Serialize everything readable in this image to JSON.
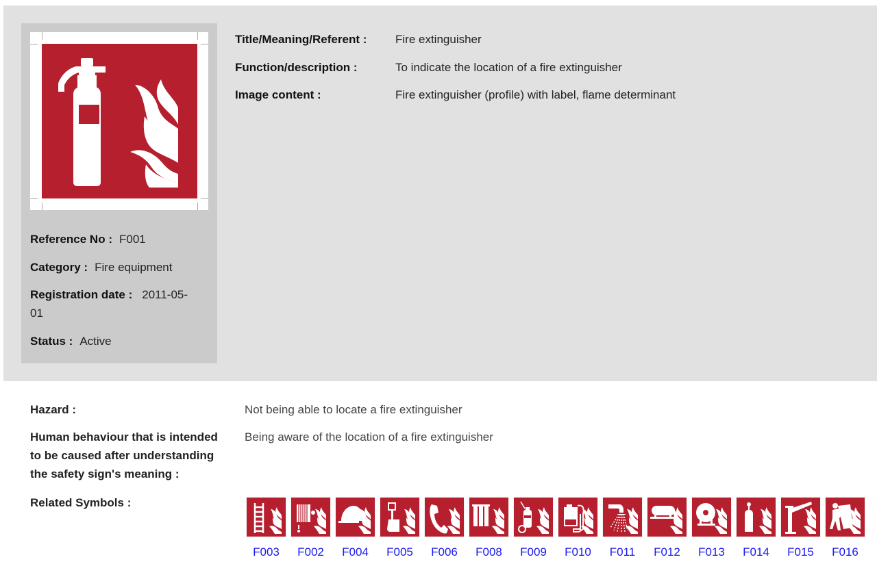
{
  "sign": {
    "icon": "fire-extinguisher-sign-icon",
    "colors": {
      "sign_red": "#b51f2e",
      "symbol": "#ffffff"
    }
  },
  "sidebar": {
    "reference": {
      "label": "Reference No :",
      "value": "F001"
    },
    "category": {
      "label": "Category :",
      "value": "Fire equipment"
    },
    "registration": {
      "label": "Registration date :",
      "value_line1": "2011-05-",
      "value_line2": "01"
    },
    "status": {
      "label": "Status :",
      "value": "Active"
    }
  },
  "info": {
    "title": {
      "label": "Title/Meaning/Referent :",
      "value": "Fire extinguisher"
    },
    "function": {
      "label": "Function/description :",
      "value": "To indicate the location of a fire extinguisher"
    },
    "image_content": {
      "label": "Image content :",
      "value": "Fire extinguisher (profile) with label, flame determinant"
    }
  },
  "details": {
    "hazard": {
      "label": "Hazard :",
      "value": "Not being able to locate a fire extinguisher"
    },
    "behaviour": {
      "label_line1": "Human behaviour that is intended",
      "label_line2": "to be caused after understanding",
      "label_line3": "the safety sign's meaning :",
      "value": "Being aware of the location of a fire extinguisher"
    },
    "related_label": "Related Symbols :"
  },
  "related_symbols": [
    {
      "code": "F003",
      "icon": "ladder-icon"
    },
    {
      "code": "F002",
      "icon": "hose-reel-icon"
    },
    {
      "code": "F004",
      "icon": "fire-hydrant-cover-icon"
    },
    {
      "code": "F005",
      "icon": "fire-alarm-call-point-icon"
    },
    {
      "code": "F006",
      "icon": "emergency-telephone-icon"
    },
    {
      "code": "F008",
      "icon": "fire-extinguishers-row-icon"
    },
    {
      "code": "F009",
      "icon": "wheeled-extinguisher-icon"
    },
    {
      "code": "F010",
      "icon": "dry-riser-inlet-icon"
    },
    {
      "code": "F011",
      "icon": "sprinkler-icon"
    },
    {
      "code": "F012",
      "icon": "fixed-fire-suppression-tank-icon"
    },
    {
      "code": "F013",
      "icon": "fire-hose-reel-icon"
    },
    {
      "code": "F014",
      "icon": "gas-cylinder-icon"
    },
    {
      "code": "F015",
      "icon": "fire-monitor-icon"
    },
    {
      "code": "F016",
      "icon": "fire-blanket-icon"
    }
  ]
}
